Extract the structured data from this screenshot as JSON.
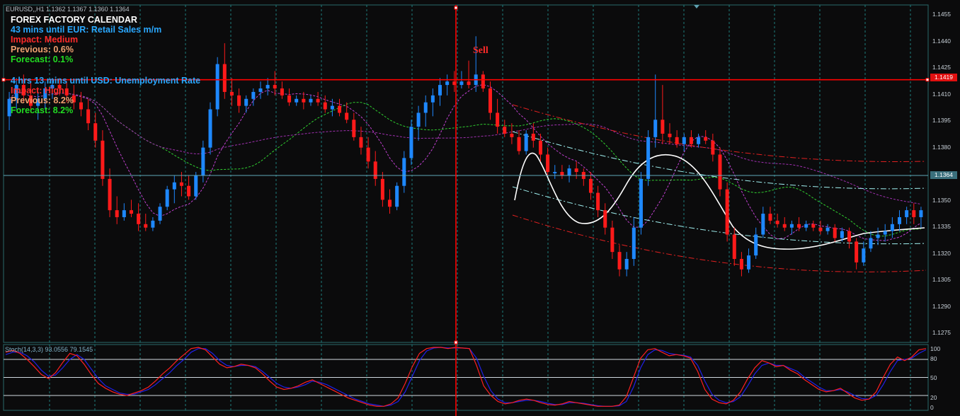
{
  "header": {
    "symbol_line": "EURUSD,,H1  1.1362 1.1367 1.1360 1.1364"
  },
  "calendar": {
    "title": "FOREX FACTORY CALENDAR",
    "event1": {
      "countdown": "43 mins until EUR: Retail Sales m/m",
      "impact": "Impact: Medium",
      "previous": "Previous: 0.6%",
      "forecast": "Forecast: 0.1%"
    },
    "event2": {
      "countdown": "4 hrs 13 mins until USD: Unemployment Rate",
      "impact": "Impact: High",
      "previous": "Previous: 8.2%",
      "forecast": "Forecast: 8.2%"
    }
  },
  "annotation": {
    "sell_label": "Sell"
  },
  "price_tags": {
    "hline": "1.1419",
    "current": "1.1364"
  },
  "price_axis": [
    "1.1455",
    "1.1440",
    "1.1425",
    "1.1410",
    "1.1395",
    "1.1380",
    "1.1365",
    "1.1350",
    "1.1335",
    "1.1320",
    "1.1305",
    "1.1290",
    "1.1275"
  ],
  "stoch": {
    "label": "Stoch(14,3,3) 93.0556 79.1545",
    "levels": [
      "100",
      "80",
      "50",
      "20",
      "0"
    ]
  },
  "colors": {
    "bull": "#1e88ff",
    "bear": "#ff1a1a",
    "title": "#ffffff",
    "countdown": "#2aa8ff",
    "impact": "#ff2a2a",
    "previous": "#f0a070",
    "forecast": "#22dd22",
    "sell": "#ff2a2a",
    "grid": "#1d7c7c",
    "hline": "#ff0000",
    "current_line": "#5fa8b8"
  },
  "chart_data": {
    "type": "candlestick",
    "ylim": [
      1.1268,
      1.1462
    ],
    "stoch_ylim": [
      0,
      100
    ],
    "hline_price": 1.1419,
    "current_price": 1.1364,
    "candles": [
      [
        1.1398,
        1.1412,
        1.139,
        1.1408
      ],
      [
        1.1408,
        1.142,
        1.1402,
        1.1416
      ],
      [
        1.1416,
        1.1422,
        1.1406,
        1.141
      ],
      [
        1.141,
        1.1418,
        1.14,
        1.1404
      ],
      [
        1.1404,
        1.1412,
        1.1396,
        1.1408
      ],
      [
        1.1408,
        1.1418,
        1.1402,
        1.1414
      ],
      [
        1.1414,
        1.142,
        1.1408,
        1.1416
      ],
      [
        1.1416,
        1.142,
        1.141,
        1.1414
      ],
      [
        1.1414,
        1.1418,
        1.1406,
        1.141
      ],
      [
        1.141,
        1.1416,
        1.1402,
        1.1406
      ],
      [
        1.1406,
        1.1412,
        1.1398,
        1.1402
      ],
      [
        1.1402,
        1.1408,
        1.139,
        1.1394
      ],
      [
        1.1394,
        1.14,
        1.138,
        1.1384
      ],
      [
        1.1384,
        1.139,
        1.1358,
        1.1362
      ],
      [
        1.1362,
        1.1368,
        1.134,
        1.1344
      ],
      [
        1.1344,
        1.1352,
        1.1336,
        1.134
      ],
      [
        1.134,
        1.1348,
        1.1338,
        1.1344
      ],
      [
        1.1344,
        1.135,
        1.134,
        1.1342
      ],
      [
        1.1342,
        1.1348,
        1.1332,
        1.1336
      ],
      [
        1.1336,
        1.1342,
        1.1332,
        1.1334
      ],
      [
        1.1334,
        1.134,
        1.1332,
        1.1338
      ],
      [
        1.1338,
        1.1348,
        1.1336,
        1.1346
      ],
      [
        1.1346,
        1.1358,
        1.1344,
        1.1356
      ],
      [
        1.1356,
        1.1364,
        1.1348,
        1.136
      ],
      [
        1.136,
        1.1366,
        1.1352,
        1.1358
      ],
      [
        1.1358,
        1.1364,
        1.135,
        1.1352
      ],
      [
        1.1352,
        1.1366,
        1.135,
        1.1364
      ],
      [
        1.1364,
        1.1384,
        1.136,
        1.138
      ],
      [
        1.138,
        1.1406,
        1.1376,
        1.1402
      ],
      [
        1.1402,
        1.1432,
        1.1398,
        1.1428
      ],
      [
        1.1428,
        1.144,
        1.1408,
        1.1412
      ],
      [
        1.1412,
        1.142,
        1.1404,
        1.141
      ],
      [
        1.141,
        1.1414,
        1.14,
        1.1404
      ],
      [
        1.1404,
        1.141,
        1.14,
        1.1408
      ],
      [
        1.1408,
        1.1414,
        1.1404,
        1.1412
      ],
      [
        1.1412,
        1.1418,
        1.1408,
        1.1414
      ],
      [
        1.1414,
        1.142,
        1.141,
        1.1416
      ],
      [
        1.1416,
        1.1424,
        1.141,
        1.1414
      ],
      [
        1.1414,
        1.1418,
        1.1408,
        1.141
      ],
      [
        1.141,
        1.1414,
        1.1404,
        1.1406
      ],
      [
        1.1406,
        1.141,
        1.1404,
        1.1408
      ],
      [
        1.1408,
        1.1412,
        1.1402,
        1.1406
      ],
      [
        1.1406,
        1.141,
        1.1404,
        1.1408
      ],
      [
        1.1408,
        1.1412,
        1.1404,
        1.1406
      ],
      [
        1.1406,
        1.141,
        1.14,
        1.1402
      ],
      [
        1.1402,
        1.1408,
        1.1398,
        1.1404
      ],
      [
        1.1404,
        1.1408,
        1.1398,
        1.14
      ],
      [
        1.14,
        1.1406,
        1.1394,
        1.1396
      ],
      [
        1.1396,
        1.14,
        1.1384,
        1.1386
      ],
      [
        1.1386,
        1.1392,
        1.1376,
        1.138
      ],
      [
        1.138,
        1.1386,
        1.1368,
        1.1372
      ],
      [
        1.1372,
        1.1378,
        1.1358,
        1.1362
      ],
      [
        1.1362,
        1.1366,
        1.1346,
        1.135
      ],
      [
        1.135,
        1.1356,
        1.1342,
        1.1346
      ],
      [
        1.1346,
        1.136,
        1.1344,
        1.1358
      ],
      [
        1.1358,
        1.1378,
        1.1354,
        1.1374
      ],
      [
        1.1374,
        1.1396,
        1.137,
        1.1392
      ],
      [
        1.1392,
        1.1404,
        1.1384,
        1.14
      ],
      [
        1.14,
        1.141,
        1.1392,
        1.1406
      ],
      [
        1.1406,
        1.1414,
        1.1398,
        1.141
      ],
      [
        1.141,
        1.142,
        1.1404,
        1.1416
      ],
      [
        1.1416,
        1.1422,
        1.141,
        1.1418
      ],
      [
        1.1418,
        1.1424,
        1.1412,
        1.1416
      ],
      [
        1.1416,
        1.1424,
        1.1414,
        1.1418
      ],
      [
        1.1418,
        1.143,
        1.1414,
        1.1416
      ],
      [
        1.1416,
        1.1444,
        1.1412,
        1.1422
      ],
      [
        1.1422,
        1.1424,
        1.1412,
        1.1414
      ],
      [
        1.1414,
        1.1418,
        1.1396,
        1.14
      ],
      [
        1.14,
        1.1408,
        1.1388,
        1.1392
      ],
      [
        1.1392,
        1.1396,
        1.1386,
        1.1388
      ],
      [
        1.1388,
        1.1394,
        1.1382,
        1.1386
      ],
      [
        1.1386,
        1.139,
        1.1376,
        1.1378
      ],
      [
        1.1378,
        1.139,
        1.1376,
        1.1388
      ],
      [
        1.1388,
        1.1394,
        1.138,
        1.1384
      ],
      [
        1.1384,
        1.1388,
        1.1372,
        1.1376
      ],
      [
        1.1376,
        1.138,
        1.1364,
        1.1366
      ],
      [
        1.1366,
        1.137,
        1.1362,
        1.1366
      ],
      [
        1.1366,
        1.137,
        1.1362,
        1.1364
      ],
      [
        1.1364,
        1.137,
        1.136,
        1.1368
      ],
      [
        1.1368,
        1.1372,
        1.1362,
        1.1366
      ],
      [
        1.1366,
        1.1368,
        1.1358,
        1.1362
      ],
      [
        1.1362,
        1.1366,
        1.135,
        1.1354
      ],
      [
        1.1354,
        1.1358,
        1.134,
        1.1344
      ],
      [
        1.1344,
        1.1348,
        1.133,
        1.1334
      ],
      [
        1.1334,
        1.1338,
        1.1316,
        1.132
      ],
      [
        1.132,
        1.1324,
        1.1306,
        1.131
      ],
      [
        1.131,
        1.132,
        1.1306,
        1.1316
      ],
      [
        1.1316,
        1.134,
        1.1312,
        1.1334
      ],
      [
        1.1334,
        1.1366,
        1.133,
        1.1362
      ],
      [
        1.1362,
        1.139,
        1.1358,
        1.1386
      ],
      [
        1.1386,
        1.1422,
        1.138,
        1.1396
      ],
      [
        1.1396,
        1.1416,
        1.1382,
        1.1388
      ],
      [
        1.1388,
        1.1394,
        1.1382,
        1.1386
      ],
      [
        1.1386,
        1.139,
        1.138,
        1.1382
      ],
      [
        1.1382,
        1.1388,
        1.1378,
        1.1386
      ],
      [
        1.1386,
        1.139,
        1.138,
        1.1382
      ],
      [
        1.1382,
        1.1388,
        1.138,
        1.1386
      ],
      [
        1.1386,
        1.139,
        1.1382,
        1.1384
      ],
      [
        1.1384,
        1.1388,
        1.1372,
        1.1376
      ],
      [
        1.1376,
        1.138,
        1.1352,
        1.1356
      ],
      [
        1.1356,
        1.136,
        1.1326,
        1.133
      ],
      [
        1.133,
        1.1334,
        1.1312,
        1.1316
      ],
      [
        1.1316,
        1.132,
        1.1306,
        1.131
      ],
      [
        1.131,
        1.1322,
        1.1308,
        1.1318
      ],
      [
        1.1318,
        1.1334,
        1.1316,
        1.133
      ],
      [
        1.133,
        1.1346,
        1.1328,
        1.1342
      ],
      [
        1.1342,
        1.1346,
        1.1336,
        1.1338
      ],
      [
        1.1338,
        1.1342,
        1.1334,
        1.1336
      ],
      [
        1.1336,
        1.134,
        1.1332,
        1.1334
      ],
      [
        1.1334,
        1.1338,
        1.133,
        1.1336
      ],
      [
        1.1336,
        1.134,
        1.1332,
        1.1334
      ],
      [
        1.1334,
        1.1338,
        1.1332,
        1.1336
      ],
      [
        1.1336,
        1.1338,
        1.1332,
        1.1334
      ],
      [
        1.1334,
        1.1338,
        1.133,
        1.1332
      ],
      [
        1.1332,
        1.1336,
        1.133,
        1.1334
      ],
      [
        1.1334,
        1.1336,
        1.1326,
        1.1328
      ],
      [
        1.1328,
        1.1334,
        1.1326,
        1.1332
      ],
      [
        1.1332,
        1.1334,
        1.1322,
        1.1326
      ],
      [
        1.1326,
        1.1328,
        1.131,
        1.1314
      ],
      [
        1.1314,
        1.1326,
        1.1312,
        1.1322
      ],
      [
        1.1322,
        1.1332,
        1.132,
        1.1328
      ],
      [
        1.1328,
        1.1334,
        1.1324,
        1.133
      ],
      [
        1.133,
        1.1336,
        1.1326,
        1.1332
      ],
      [
        1.1332,
        1.134,
        1.1328,
        1.1336
      ],
      [
        1.1336,
        1.1344,
        1.1332,
        1.134
      ],
      [
        1.134,
        1.1346,
        1.1336,
        1.1344
      ],
      [
        1.1344,
        1.1348,
        1.1336,
        1.134
      ],
      [
        1.134,
        1.1346,
        1.1334,
        1.1344
      ]
    ],
    "stoch_main": [
      92,
      95,
      90,
      80,
      68,
      55,
      48,
      58,
      75,
      90,
      86,
      72,
      55,
      40,
      32,
      26,
      22,
      20,
      24,
      28,
      34,
      44,
      56,
      66,
      78,
      88,
      98,
      100,
      96,
      84,
      72,
      66,
      68,
      72,
      70,
      66,
      56,
      44,
      34,
      30,
      32,
      36,
      42,
      46,
      40,
      34,
      28,
      22,
      16,
      12,
      8,
      4,
      2,
      2,
      6,
      16,
      40,
      68,
      90,
      98,
      100,
      100,
      98,
      100,
      99,
      98,
      70,
      36,
      20,
      10,
      6,
      8,
      12,
      14,
      12,
      8,
      5,
      4,
      6,
      10,
      8,
      6,
      4,
      2,
      2,
      2,
      4,
      18,
      50,
      82,
      96,
      98,
      92,
      86,
      88,
      86,
      82,
      60,
      30,
      14,
      8,
      6,
      12,
      26,
      48,
      66,
      78,
      74,
      68,
      70,
      62,
      56,
      46,
      38,
      30,
      26,
      28,
      32,
      24,
      16,
      12,
      14,
      26,
      50,
      72,
      84,
      78,
      84,
      96,
      98
    ],
    "stoch_signal": [
      88,
      92,
      92,
      86,
      76,
      62,
      52,
      54,
      66,
      80,
      88,
      80,
      64,
      48,
      36,
      30,
      24,
      22,
      22,
      26,
      30,
      38,
      48,
      58,
      70,
      80,
      92,
      98,
      98,
      90,
      78,
      70,
      68,
      70,
      70,
      68,
      60,
      50,
      40,
      34,
      32,
      34,
      38,
      44,
      42,
      38,
      32,
      26,
      20,
      14,
      10,
      6,
      4,
      2,
      4,
      10,
      26,
      52,
      78,
      94,
      99,
      100,
      99,
      99,
      99,
      98,
      82,
      52,
      28,
      14,
      8,
      8,
      10,
      12,
      12,
      10,
      7,
      5,
      5,
      8,
      8,
      7,
      5,
      3,
      2,
      2,
      3,
      10,
      34,
      66,
      88,
      96,
      95,
      90,
      88,
      87,
      84,
      70,
      44,
      22,
      12,
      8,
      10,
      18,
      36,
      56,
      70,
      74,
      70,
      70,
      65,
      60,
      50,
      42,
      34,
      28,
      28,
      30,
      26,
      20,
      15,
      14,
      20,
      38,
      60,
      78,
      80,
      82,
      90,
      96
    ]
  }
}
